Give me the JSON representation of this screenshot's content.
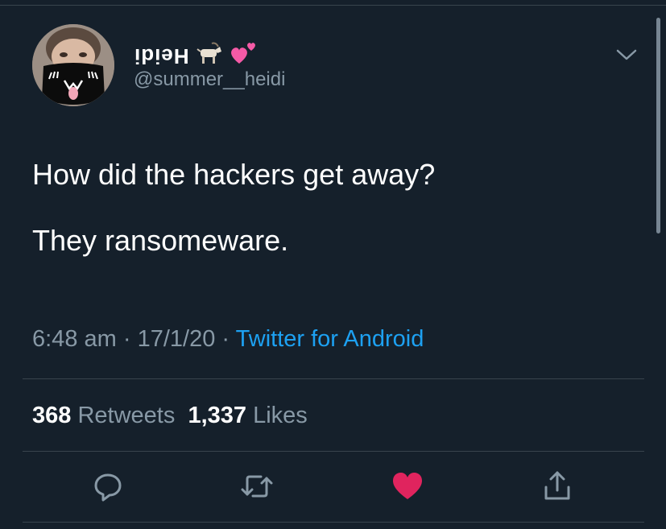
{
  "user": {
    "display_name": "Heidi",
    "emojis": [
      "goat",
      "two-hearts"
    ],
    "handle": "@summer__heidi"
  },
  "tweet": {
    "lines": [
      "How did the hackers get away?",
      "They ransomeware."
    ]
  },
  "meta": {
    "time": "6:48 am",
    "date": "17/1/20",
    "separator": "·",
    "source": "Twitter for Android"
  },
  "stats": {
    "retweets_count": "368",
    "retweets_label": "Retweets",
    "likes_count": "1,337",
    "likes_label": "Likes"
  },
  "actions": {
    "reply_icon": "reply-icon",
    "retweet_icon": "retweet-icon",
    "like_icon": "heart-icon",
    "share_icon": "share-icon"
  },
  "colors": {
    "background": "#15202b",
    "link": "#1da1f2",
    "muted": "#8899a6",
    "like": "#e0245e",
    "divider": "#38444d"
  }
}
